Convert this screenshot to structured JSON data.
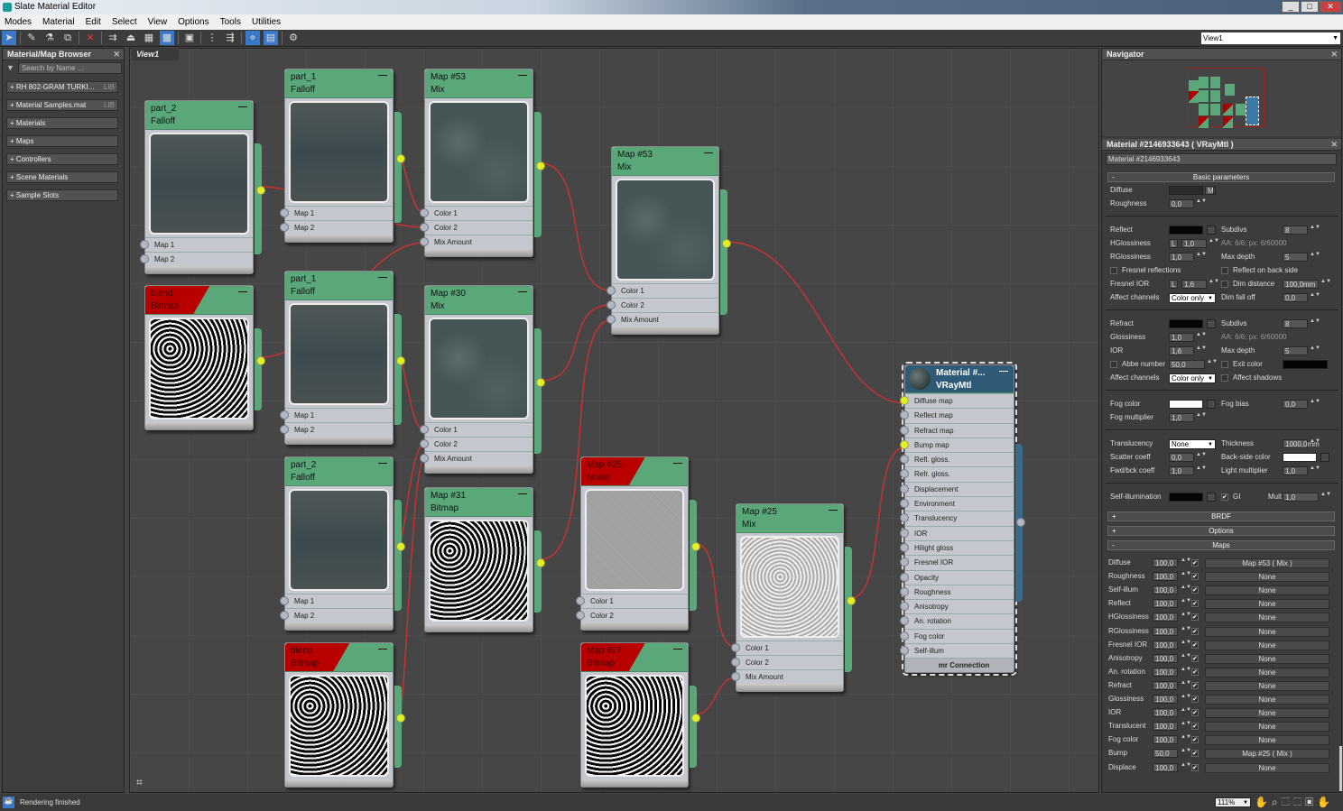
{
  "window": {
    "title": "Slate Material Editor",
    "controls": [
      "_",
      "□",
      "✕"
    ]
  },
  "menu": [
    "Modes",
    "Material",
    "Edit",
    "Select",
    "View",
    "Options",
    "Tools",
    "Utilities"
  ],
  "view_select": "View1",
  "browser": {
    "title": "Material/Map Browser",
    "search_placeholder": "Search by Name ...",
    "groups": [
      {
        "label": "+ RH 802-GRAM TURKI...",
        "tag": "LIB"
      },
      {
        "label": "+ Material Samples.mat",
        "tag": "LIB"
      },
      {
        "label": "+ Materials"
      },
      {
        "label": "+ Maps"
      },
      {
        "label": "+ Controllers"
      },
      {
        "label": "+ Scene Materials"
      },
      {
        "label": "+ Sample Slots"
      }
    ]
  },
  "view_tab": "View1",
  "nodes": [
    {
      "name": "part_2",
      "type": "Falloff",
      "slots": [
        "Map 1",
        "Map 2"
      ]
    },
    {
      "name": "part_1",
      "type": "Falloff",
      "slots": [
        "Map 1",
        "Map 2"
      ]
    },
    {
      "name": "Map #53",
      "type": "Mix",
      "slots": [
        "Color 1",
        "Color 2",
        "Mix Amount"
      ]
    },
    {
      "name": "Map #53",
      "type": "Mix",
      "slots": [
        "Color 1",
        "Color 2",
        "Mix Amount"
      ]
    },
    {
      "name": "blend",
      "type": "Bitmap",
      "slots": []
    },
    {
      "name": "part_1",
      "type": "Falloff",
      "slots": [
        "Map 1",
        "Map 2"
      ]
    },
    {
      "name": "Map #30",
      "type": "Mix",
      "slots": [
        "Color 1",
        "Color 2",
        "Mix Amount"
      ]
    },
    {
      "name": "part_2",
      "type": "Falloff",
      "slots": [
        "Map 1",
        "Map 2"
      ]
    },
    {
      "name": "Map #31",
      "type": "Bitmap",
      "slots": []
    },
    {
      "name": "blend",
      "type": "Bitmap",
      "slots": []
    },
    {
      "name": "Map #25",
      "type": "Noise",
      "slots": [
        "Color 1",
        "Color 2"
      ]
    },
    {
      "name": "Map #27",
      "type": "Bitmap",
      "slots": []
    },
    {
      "name": "Map #25",
      "type": "Mix",
      "slots": [
        "Color 1",
        "Color 2",
        "Mix Amount"
      ]
    }
  ],
  "material_node": {
    "name": "Material #...",
    "type": "VRayMtl",
    "slots": [
      "Diffuse map",
      "Reflect map",
      "Refract map",
      "Bump map",
      "Refl. gloss.",
      "Refr. gloss.",
      "Displacement",
      "Environment",
      "Translucency",
      "IOR",
      "Hilight gloss",
      "Fresnel IOR",
      "Opacity",
      "Roughness",
      "Anisotropy",
      "An. rotation",
      "Fog color",
      "Self-illum"
    ],
    "footer": "mr Connection",
    "connected": [
      0,
      3
    ]
  },
  "navigator": {
    "title": "Navigator"
  },
  "material_panel": {
    "title": "Material #2146933643  ( VRayMtl )",
    "name_field": "Material #2146933643",
    "basic_title": "Basic parameters",
    "rows": [
      [
        [
          "Diffuse",
          "sw:#2a2a2a",
          "M"
        ],
        null
      ],
      [
        [
          "Roughness",
          "n:0,0"
        ],
        null
      ],
      "gap",
      [
        [
          "Reflect",
          "sw:#050505"
        ],
        [
          "Subdivs",
          "n:8"
        ]
      ],
      [
        [
          "HGlossiness",
          "L:1,0"
        ],
        [
          "AA: 6/6; px: 6/60000",
          "t"
        ]
      ],
      [
        [
          "RGlossiness",
          "n:1,0"
        ],
        [
          "Max depth",
          "n:5"
        ]
      ],
      [
        [
          "Fresnel reflections",
          "c:0"
        ],
        [
          "Reflect on back side",
          "c:0"
        ]
      ],
      [
        [
          "Fresnel IOR",
          "L:1,6"
        ],
        [
          "Dim distance",
          "cn:100,0mm"
        ]
      ],
      [
        [
          "Affect channels",
          "d:Color only"
        ],
        [
          "Dim fall off",
          "n:0,0"
        ]
      ],
      "gap",
      [
        [
          "Refract",
          "sw:#050505"
        ],
        [
          "Subdivs",
          "n:8"
        ]
      ],
      [
        [
          "Glossiness",
          "n:1,0"
        ],
        [
          "AA: 6/6; px: 6/60000",
          "t"
        ]
      ],
      [
        [
          "IOR",
          "n:1,6"
        ],
        [
          "Max depth",
          "n:5"
        ]
      ],
      [
        [
          "Abbe number",
          "cn:50,0"
        ],
        [
          "Exit color",
          "csw:#050505"
        ]
      ],
      [
        [
          "Affect channels",
          "d:Color only"
        ],
        [
          "Affect shadows",
          "c:0"
        ]
      ],
      "gap",
      [
        [
          "Fog color",
          "sw:#ffffff"
        ],
        [
          "Fog bias",
          "n:0,0"
        ]
      ],
      [
        [
          "Fog multiplier",
          "n:1,0"
        ],
        null
      ],
      "gap",
      [
        [
          "Translucency",
          "d:None"
        ],
        [
          "Thickness",
          "n:1000,0mm"
        ]
      ],
      [
        [
          "Scatter coeff",
          "n:0,0"
        ],
        [
          "Back-side color",
          "sw:#ffffff"
        ]
      ],
      [
        [
          "Fwd/bck coeff",
          "n:1,0"
        ],
        [
          "Light multiplier",
          "n:1,0"
        ]
      ],
      "gap",
      [
        [
          "Self-illumination",
          "sw:#050505"
        ],
        [
          "GI",
          "gi:Mult:1,0"
        ]
      ]
    ],
    "rollouts": [
      {
        "sign": "+",
        "label": "BRDF"
      },
      {
        "sign": "+",
        "label": "Options"
      },
      {
        "sign": "-",
        "label": "Maps"
      }
    ],
    "maps": [
      [
        "Diffuse",
        "100,0",
        "Map #53  ( Mix )"
      ],
      [
        "Roughness",
        "100,0",
        "None"
      ],
      [
        "Self-illum",
        "100,0",
        "None"
      ],
      [
        "Reflect",
        "100,0",
        "None"
      ],
      [
        "HGlossiness",
        "100,0",
        "None"
      ],
      [
        "RGlossiness",
        "100,0",
        "None"
      ],
      [
        "Fresnel IOR",
        "100,0",
        "None"
      ],
      [
        "Anisotropy",
        "100,0",
        "None"
      ],
      [
        "An. rotation",
        "100,0",
        "None"
      ],
      [
        "Refract",
        "100,0",
        "None"
      ],
      [
        "Glossiness",
        "100,0",
        "None"
      ],
      [
        "IOR",
        "100,0",
        "None"
      ],
      [
        "Translucent",
        "100,0",
        "None"
      ],
      [
        "Fog color",
        "100,0",
        "None"
      ],
      [
        "Bump",
        "50,0",
        "Map #25  ( Mix )"
      ],
      [
        "Displace",
        "100,0",
        "None"
      ]
    ]
  },
  "status": {
    "text": "Rendering finished",
    "zoom": "111%"
  },
  "colors": {
    "node_header": "#5aa87a",
    "wire": "#d03030",
    "pin_connected": "#e0f020",
    "material_header": "#2e5a78"
  }
}
